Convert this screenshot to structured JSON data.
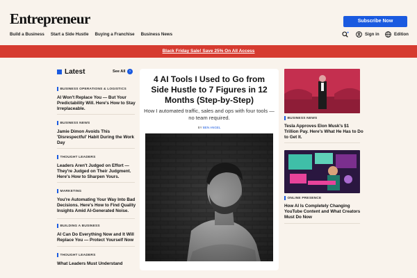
{
  "header": {
    "logo": "Entrepreneur",
    "subscribe_label": "Subscribe Now",
    "nav": [
      "Build a Business",
      "Start a Side Hustle",
      "Buying a Franchise",
      "Business News"
    ],
    "signin_label": "Sign in",
    "edition_label": "Edition"
  },
  "banner": {
    "text": "Black Friday Sale! Save 25% On All Access"
  },
  "latest": {
    "title": "Latest",
    "see_all": "See All",
    "items": [
      {
        "category": "BUSINESS OPERATIONS & LOGISTICS",
        "headline": "AI Won't Replace You — But Your Predictability Will. Here's How to Stay Irreplaceable."
      },
      {
        "category": "BUSINESS NEWS",
        "headline": "Jamie Dimon Avoids This 'Disrespectful' Habit During the Work Day"
      },
      {
        "category": "THOUGHT LEADERS",
        "headline": "Leaders Aren't Judged on Effort — They're Judged on Their Judgment. Here's How to Sharpen Yours."
      },
      {
        "category": "MARKETING",
        "headline": "You're Automating Your Way Into Bad Decisions. Here's How to Find Quality Insights Amid AI-Generated Noise."
      },
      {
        "category": "BUILDING A BUSINESS",
        "headline": "AI Can Do Everything Now and It Will Replace You — Protect Yourself Now"
      },
      {
        "category": "THOUGHT LEADERS",
        "headline": "What Leaders Must Understand"
      }
    ]
  },
  "feature": {
    "title": "4 AI Tools I Used to Go from Side Hustle to 7 Figures in 12 Months (Step-by-Step)",
    "dek": "How I automated traffic, sales and ops with four tools — no team required.",
    "byline_prefix": "BY",
    "author": "BEN ANGEL"
  },
  "side": [
    {
      "category": "BUSINESS NEWS",
      "headline": "Tesla Approves Elon Musk's $1 Trillion Pay. Here's What He Has to Do to Get It."
    },
    {
      "category": "ONLINE PRESENCE",
      "headline": "How AI Is Completely Changing YouTube Content and What Creators Must Do Now"
    }
  ],
  "colors": {
    "accent": "#1a5ae0",
    "banner": "#d63b30",
    "background": "#f9f3ec"
  }
}
